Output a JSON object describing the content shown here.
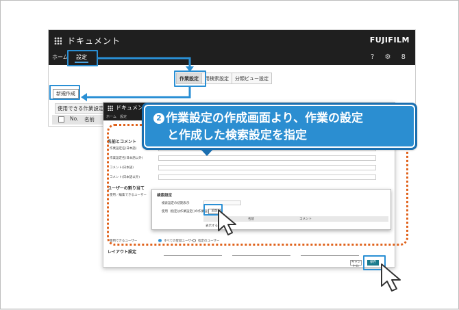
{
  "app": {
    "title": "ドキュメント",
    "brand": "FUJIFILM",
    "nav_home": "ホーム",
    "nav_settings": "設定",
    "nav_icons": "? ⚙ 8",
    "sub_tabs": [
      "作業設定",
      "用検索設定",
      "分類ビュー設定"
    ],
    "new_button": "新規作成",
    "section_label": "使用できる作業設定",
    "table_headers": {
      "no": "No.",
      "name": "名前"
    }
  },
  "editor": {
    "title": "ドキュメント",
    "nav_home": "ホーム",
    "nav_settings": "設定",
    "section_name": "名前とコメント",
    "fields": [
      "作業設定名(日本語)",
      "作業設定名(日本語以外)",
      "コメント(日本語)",
      "コメント(日本語以外)"
    ],
    "section_assign": "ユーザーの割り当て",
    "assign_label": "使用／編集できるユーザー",
    "usable_label": "使用できるユーザー",
    "radio_all": "すべての登録ユーザー",
    "radio_specific": "指定のユーザー",
    "section_layout": "レイアウト設定",
    "cancel": "キャンセル",
    "save": "保存"
  },
  "popup": {
    "title": "検索設定",
    "row1_label": "検索設定の初期表示",
    "row2_label": "使用（指定は作業設定()の作業設定）",
    "add_button": "追加",
    "col_name": "名前",
    "col_comment": "コメント",
    "footer": "表示する検索"
  },
  "callout": {
    "step": "2",
    "line1": "作業設定の作成画面より、作業の設定",
    "line2": "と作成した検索設定を指定"
  },
  "colors": {
    "highlight": "#2a8fd4",
    "callout": "#2b8ed1",
    "dotted": "#e0621b",
    "save": "#1a7a8c"
  }
}
